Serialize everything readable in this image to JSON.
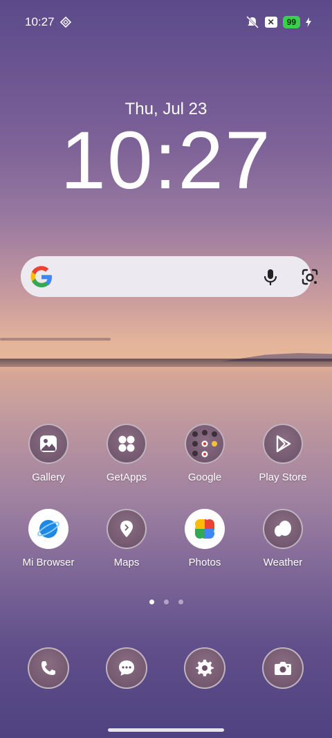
{
  "status_bar": {
    "time": "10:27",
    "battery": "99"
  },
  "lock_clock": {
    "date": "Thu, Jul 23",
    "time": "10:27"
  },
  "apps": [
    {
      "label": "Gallery",
      "icon": "gallery-icon"
    },
    {
      "label": "GetApps",
      "icon": "getapps-icon"
    },
    {
      "label": "Google",
      "icon": "google-folder-icon"
    },
    {
      "label": "Play Store",
      "icon": "play-store-icon"
    },
    {
      "label": "Mi Browser",
      "icon": "mi-browser-icon"
    },
    {
      "label": "Maps",
      "icon": "maps-icon"
    },
    {
      "label": "Photos",
      "icon": "photos-icon"
    },
    {
      "label": "Weather",
      "icon": "weather-icon"
    }
  ],
  "dock": [
    {
      "icon": "phone-icon"
    },
    {
      "icon": "messages-icon"
    },
    {
      "icon": "settings-icon"
    },
    {
      "icon": "camera-icon"
    }
  ],
  "pages": {
    "count": 3,
    "active": 1
  },
  "colors": {
    "battery_green": "#3ad04b",
    "search_bg": "#eceaf0"
  }
}
